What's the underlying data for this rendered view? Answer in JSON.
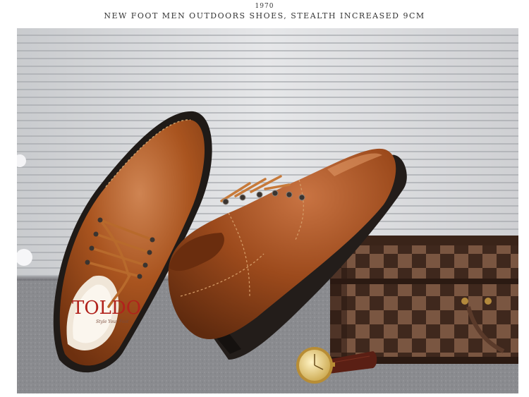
{
  "header": {
    "code": "1970",
    "title": "NEW FOOT MEN OUTDOORS SHOES, STEALTH INCREASED 9CM"
  },
  "photo": {
    "subject": "brown-leather-lace-up-shoes",
    "insole_brand": "TOLDO",
    "insole_tagline": "Style Your Foot",
    "colors": {
      "leather": "#9a4a1e",
      "leather_highlight": "#c2733f",
      "sole": "#2a2522",
      "wall": "#d9dadc",
      "floor": "#8e8f93",
      "case_dark": "#4a3024",
      "case_light": "#7d5a44",
      "watch_gold": "#c9a54a",
      "watch_strap": "#5a1f14"
    }
  }
}
